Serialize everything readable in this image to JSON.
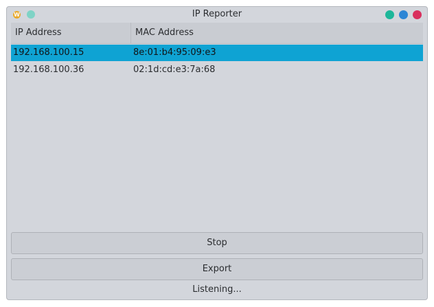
{
  "window": {
    "title": "IP Reporter",
    "app_icon_glyph": "W",
    "icons": {
      "app": "app-logo-icon",
      "pin": "pin-icon",
      "minimize": "minimize-icon",
      "maximize": "maximize-icon",
      "close": "close-icon"
    },
    "colors": {
      "minimize": "#1db79a",
      "maximize": "#2d86d5",
      "close": "#d9305e",
      "selection": "#0fa3d3"
    }
  },
  "table": {
    "columns": [
      "IP Address",
      "MAC Address"
    ],
    "rows": [
      {
        "ip": "192.168.100.15",
        "mac": "8e:01:b4:95:09:e3",
        "selected": true
      },
      {
        "ip": "192.168.100.36",
        "mac": "02:1d:cd:e3:7a:68",
        "selected": false
      }
    ]
  },
  "buttons": {
    "stop": "Stop",
    "export": "Export"
  },
  "status": "Listening..."
}
